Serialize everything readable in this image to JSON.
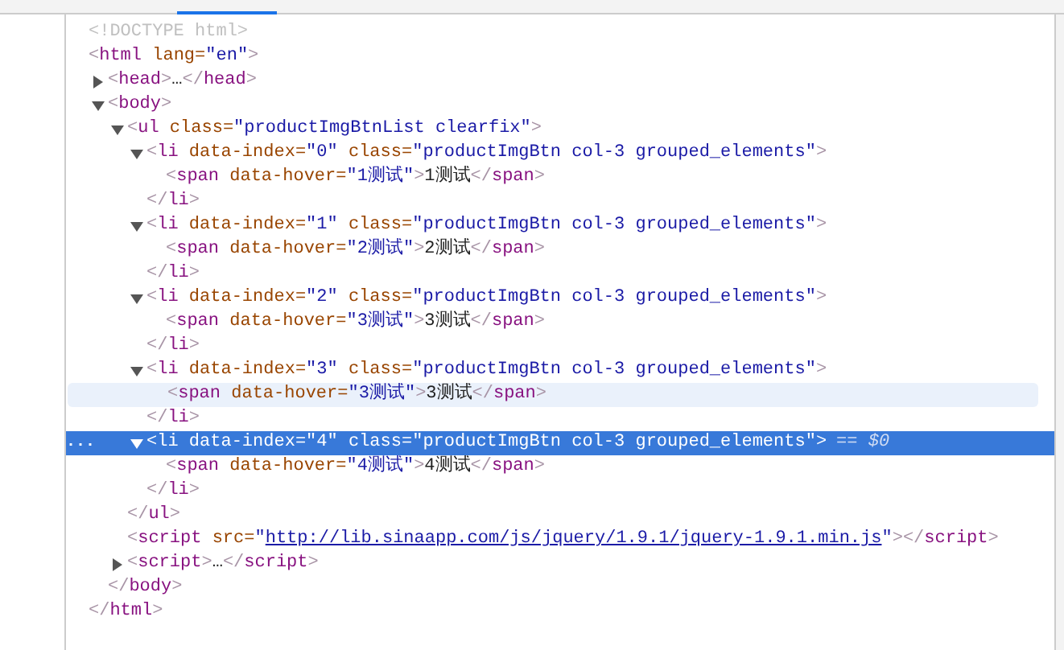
{
  "dom_tree": [
    {
      "kind": "doctype",
      "text": "<!DOCTYPE html>"
    },
    {
      "kind": "element",
      "open_tag": "<html lang=\"en\">",
      "close_tag": "</html>",
      "selected": false,
      "hovered": false,
      "children": [
        {
          "kind": "element",
          "open_tag": "<head>",
          "content": "…",
          "close_tag": "</head>",
          "expanded": false,
          "selected": false,
          "hovered": false
        },
        {
          "kind": "element",
          "open_tag": "<body>",
          "close_tag": "</body>",
          "expanded": true,
          "selected": false,
          "hovered": false,
          "children": [
            {
              "kind": "element",
              "open_tag": "<ul class=\"productImgBtnList clearfix\">",
              "close_tag": "</ul>",
              "expanded": true,
              "selected": false,
              "hovered": false,
              "children": [
                {
                  "kind": "element",
                  "open_tag": "<li data-index=\"0\" class=\"productImgBtn col-3 grouped_elements\">",
                  "close_tag": "</li>",
                  "expanded": true,
                  "selected": false,
                  "hovered": false,
                  "children": [
                    {
                      "kind": "element",
                      "open_tag": "<span data-hover=\"1测试\">",
                      "text": "1测试",
                      "close_tag": "</span>",
                      "selected": false,
                      "hovered": false
                    }
                  ]
                },
                {
                  "kind": "element",
                  "open_tag": "<li data-index=\"1\" class=\"productImgBtn col-3 grouped_elements\">",
                  "close_tag": "</li>",
                  "expanded": true,
                  "selected": false,
                  "hovered": false,
                  "children": [
                    {
                      "kind": "element",
                      "open_tag": "<span data-hover=\"2测试\">",
                      "text": "2测试",
                      "close_tag": "</span>",
                      "selected": false,
                      "hovered": false
                    }
                  ]
                },
                {
                  "kind": "element",
                  "open_tag": "<li data-index=\"2\" class=\"productImgBtn col-3 grouped_elements\">",
                  "close_tag": "</li>",
                  "expanded": true,
                  "selected": false,
                  "hovered": false,
                  "children": [
                    {
                      "kind": "element",
                      "open_tag": "<span data-hover=\"3测试\">",
                      "text": "3测试",
                      "close_tag": "</span>",
                      "selected": false,
                      "hovered": false
                    }
                  ]
                },
                {
                  "kind": "element",
                  "open_tag": "<li data-index=\"3\" class=\"productImgBtn col-3 grouped_elements\">",
                  "close_tag": "</li>",
                  "expanded": true,
                  "selected": false,
                  "hovered": false,
                  "children": [
                    {
                      "kind": "element",
                      "open_tag": "<span data-hover=\"3测试\">",
                      "text": "3测试",
                      "close_tag": "</span>",
                      "selected": false,
                      "hovered": true
                    }
                  ]
                },
                {
                  "kind": "element",
                  "open_tag": "<li data-index=\"4\" class=\"productImgBtn col-3 grouped_elements\">",
                  "close_tag": "</li>",
                  "expanded": true,
                  "selected": true,
                  "hovered": false,
                  "gutter": "...",
                  "badge": "== $0",
                  "children": [
                    {
                      "kind": "element",
                      "open_tag": "<span data-hover=\"4测试\">",
                      "text": "4测试",
                      "close_tag": "</span>",
                      "selected": false,
                      "hovered": false
                    }
                  ]
                }
              ]
            },
            {
              "kind": "element",
              "open_tag": "<script src=\"http://lib.sinaapp.com/js/jquery/1.9.1/jquery-1.9.1.min.js\">",
              "close_tag": "</script>",
              "link": true,
              "selected": false,
              "hovered": false
            },
            {
              "kind": "element",
              "open_tag": "<script>",
              "content": "…",
              "close_tag": "</script>",
              "expanded": false,
              "selected": false,
              "hovered": false
            }
          ]
        }
      ]
    }
  ]
}
